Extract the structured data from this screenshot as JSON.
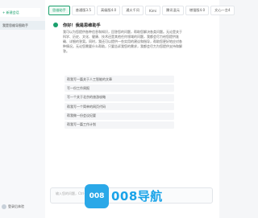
{
  "sidebar": {
    "new_chat": "+ 新建会话",
    "conversations": [
      "我是思维导图助手"
    ],
    "user": "登录后体验"
  },
  "tabs": [
    "思维助手",
    "普通版3.5",
    "高级版4.0",
    "通义千问",
    "Kimi",
    "腾讯混元",
    "增强版4.0",
    "文心一言4"
  ],
  "welcome": {
    "title": "你好！我是思维助手",
    "body": "我可以为您提供各种信息和知识，回答您的问题，帮助您解决各类问题。无论是关于科学、历史、文化、健康、技术还是其他任何领域的问题，我都会尽力给您提供准确、详细的答案。同时，我还可以提供一些实用的建议和指导，帮助您更好地应对各种情况。无论您需要什么帮助，只要告诉我您的需求，我都会尽力为您提供支持和解答。"
  },
  "suggestions": [
    "帮我写一篇关于人工智能的文章",
    "写一份工作周报",
    "写一个关于北京的旅游攻略",
    "帮我写一个简单的网页代码",
    "帮我做一份会议纪要",
    "帮我写一篇工作计划"
  ],
  "input": {
    "placeholder": "输入您的问题，Ctrl+回车发送"
  },
  "watermark": {
    "logo_text": "008",
    "text": "008导航"
  }
}
